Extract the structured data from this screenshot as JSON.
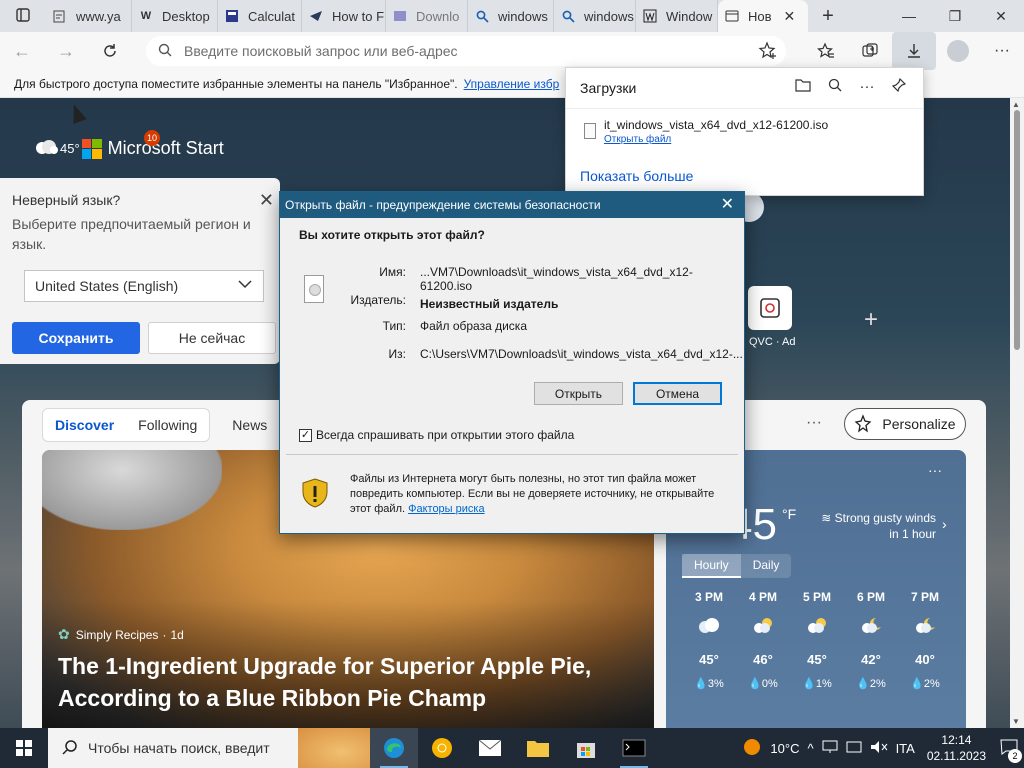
{
  "tabs": [
    {
      "title": "www.ya",
      "icon": "yandex-icon"
    },
    {
      "title": "Desktop",
      "icon": "wikipedia-icon"
    },
    {
      "title": "Calculat",
      "icon": "calculator-site-icon"
    },
    {
      "title": "How to F",
      "icon": "howto-icon"
    },
    {
      "title": "Downlo",
      "icon": "download-site-icon"
    },
    {
      "title": "windows",
      "icon": "search-icon"
    },
    {
      "title": "windows",
      "icon": "search-icon"
    },
    {
      "title": "Window",
      "icon": "wikipedia-icon"
    },
    {
      "title": "Нов",
      "icon": "newtab-icon",
      "active": true
    }
  ],
  "address_bar": {
    "placeholder": "Введите поисковый запрос или веб-адрес"
  },
  "favorites_bar": {
    "text": "Для быстрого доступа поместите избранные элементы на панель \"Избранное\".",
    "link": "Управление избр"
  },
  "newtab": {
    "weather_temp": "45°",
    "brand": "Microsoft Start",
    "notification_count": "10",
    "language_popup": {
      "question": "Неверный язык?",
      "hint": "Выберите предпочитаемый регион и язык.",
      "selected": "United States (English)",
      "save": "Сохранить",
      "not_now": "Не сейчас"
    },
    "quick_link": "QVC",
    "quick_link_ad": "Ad",
    "feed_tabs": [
      "Discover",
      "Following"
    ],
    "news_tab": "News",
    "personalize": "Personalize",
    "hero": {
      "source": "Simply Recipes",
      "age": "1d",
      "headline": "The 1-Ingredient Upgrade for Superior Apple Pie, According to a Blue Ribbon Pie Champ"
    },
    "weather": {
      "temp": "45",
      "unit": "°F",
      "wind": "Strong gusty winds in 1 hour",
      "toggle": [
        "Hourly",
        "Daily"
      ],
      "hours": [
        {
          "time": "3 PM",
          "icon": "cloud-icon",
          "temp": "45°",
          "precip": "3%"
        },
        {
          "time": "4 PM",
          "icon": "partly-cloudy-icon",
          "temp": "46°",
          "precip": "0%"
        },
        {
          "time": "5 PM",
          "icon": "partly-cloudy-icon",
          "temp": "45°",
          "precip": "1%"
        },
        {
          "time": "6 PM",
          "icon": "night-cloudy-icon",
          "temp": "42°",
          "precip": "2%"
        },
        {
          "time": "7 PM",
          "icon": "night-cloudy-icon",
          "temp": "40°",
          "precip": "2%"
        }
      ]
    }
  },
  "downloads": {
    "title": "Загрузки",
    "file": "it_windows_vista_x64_dvd_x12-61200.iso",
    "open_file": "Открыть файл",
    "show_more": "Показать больше"
  },
  "dialog": {
    "title": "Открыть файл - предупреждение системы безопасности",
    "question": "Вы хотите открыть этот файл?",
    "name_label": "Имя:",
    "name_value": "...VM7\\Downloads\\it_windows_vista_x64_dvd_x12-61200.iso",
    "publisher_label": "Издатель:",
    "publisher_value": "Неизвестный издатель",
    "type_label": "Тип:",
    "type_value": "Файл образа диска",
    "from_label": "Из:",
    "from_value": "C:\\Users\\VM7\\Downloads\\it_windows_vista_x64_dvd_x12-...",
    "open_btn": "Открыть",
    "cancel_btn": "Отмена",
    "always_ask": "Всегда спрашивать при открытии этого файла",
    "warning": "Файлы из Интернета могут быть полезны, но этот тип файла может повредить компьютер. Если вы не доверяете источнику, не открывайте этот файл.",
    "risk_link": "Факторы риска"
  },
  "taskbar": {
    "search_placeholder": "Чтобы начать поиск, введит",
    "temperature": "10°C",
    "language": "ITA",
    "time": "12:14",
    "date": "02.11.2023",
    "notifications": "2"
  },
  "colors": {
    "accent": "#2266e3",
    "dialog_title": "#1f5a7f",
    "taskbar": "#1f2a36"
  }
}
